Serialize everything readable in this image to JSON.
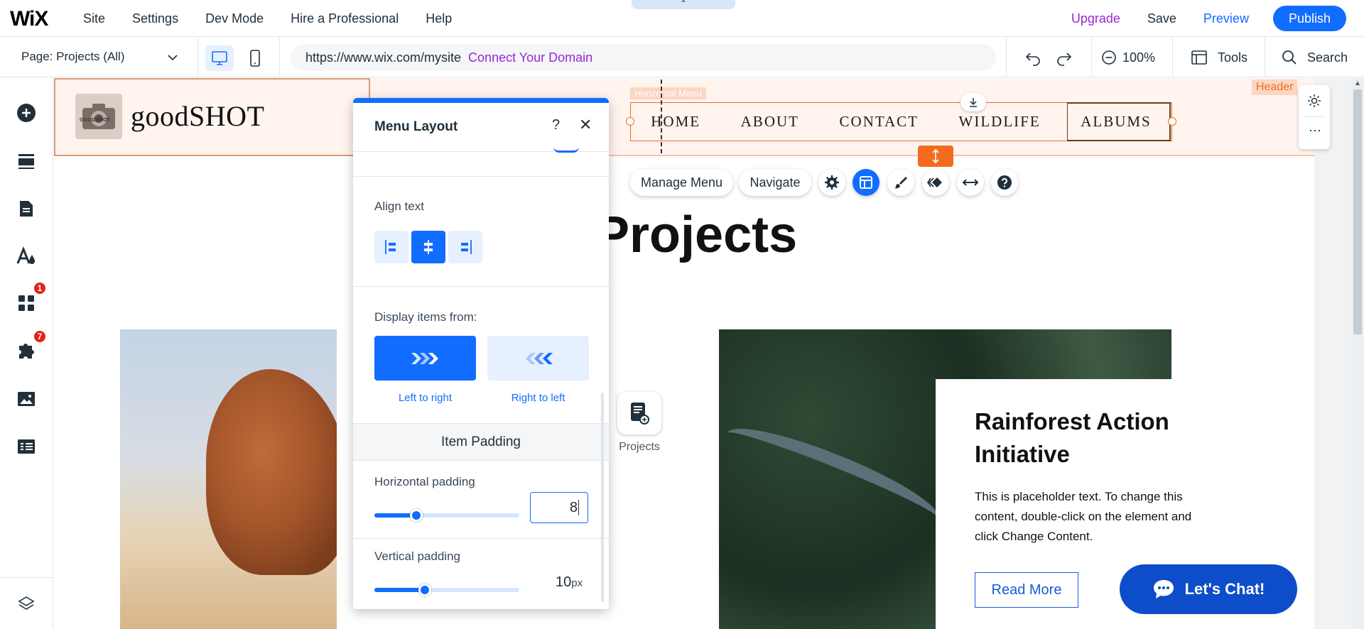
{
  "topbar": {
    "logo": "WiX",
    "menu": [
      "Site",
      "Settings",
      "Dev Mode",
      "Hire a Professional",
      "Help"
    ],
    "upgrade": "Upgrade",
    "save": "Save",
    "preview": "Preview",
    "publish": "Publish",
    "handle_glyph": "⌃"
  },
  "secondbar": {
    "page_selector": "Page: Projects (All)",
    "url": "https://www.wix.com/mysite",
    "connect_domain": "Connect Your Domain",
    "zoom": "100%",
    "tools": "Tools",
    "search": "Search"
  },
  "sidebar": {
    "badges": {
      "apps": "1",
      "plugins": "7"
    }
  },
  "site": {
    "brand": "goodSHOT",
    "logo_caption": "GOODSHOT",
    "header_label": "Header",
    "menu_label": "Horizontal Menu",
    "menu_items": [
      "HOME",
      "ABOUT",
      "CONTACT",
      "WILDLIFE",
      "ALBUMS"
    ],
    "page_title": "Projects",
    "card_title": "Rainforest Action Initiative",
    "card_text": "This is placeholder text. To change this content, double-click on the element and click Change Content.",
    "read_more": "Read More",
    "chat": "Let's Chat!",
    "projects_icon_label": "Projects"
  },
  "floating_toolbar": {
    "manage_menu": "Manage Menu",
    "navigate": "Navigate"
  },
  "panel": {
    "title": "Menu Layout",
    "help": "?",
    "close": "✕",
    "align_text_label": "Align text",
    "align_selected": "center",
    "display_items_label": "Display items from:",
    "left_to_right": "Left to right",
    "right_to_left": "Right to left",
    "direction_selected": "left-to-right",
    "item_padding": "Item Padding",
    "horizontal_padding_label": "Horizontal padding",
    "horizontal_padding_value": "8",
    "horizontal_padding_fraction": 0.29,
    "vertical_padding_label": "Vertical padding",
    "vertical_padding_value": "10",
    "vertical_padding_unit": "px",
    "vertical_padding_fraction": 0.35
  },
  "colors": {
    "accent": "#116dff",
    "upgrade": "#9a27d5",
    "selection": "#f26b1f",
    "chat": "#0d4dc9",
    "badge": "#e62214"
  }
}
